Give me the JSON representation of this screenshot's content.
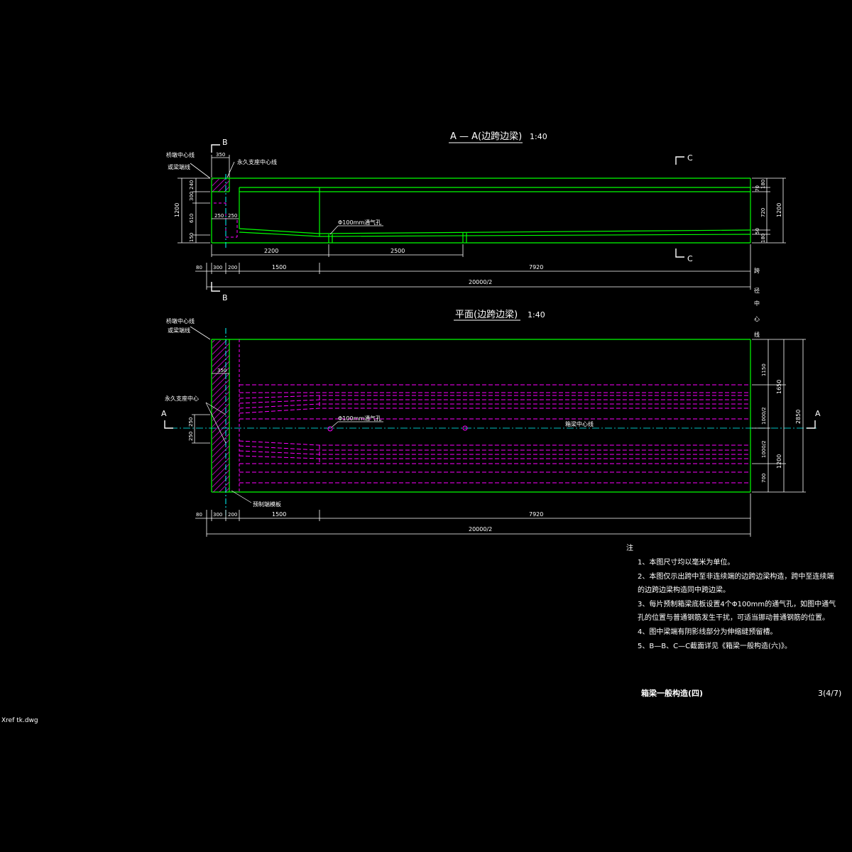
{
  "section_aa": {
    "title": "A — A(边跨边梁)",
    "scale": "1:40",
    "label_joint_line": "桥墩中心线",
    "label_joint_line2": "或梁端线",
    "label_bearing": "永久支座中心线",
    "vent_label": "Φ100mm通气孔",
    "dims": {
      "d350": "350",
      "d240": "240",
      "d300": "300",
      "d610": "610",
      "d150": "150",
      "d1200": "1200",
      "d250a": "250",
      "d250b": "250",
      "d2200": "2200",
      "d2500": "2500",
      "r70": "70",
      "r180": "180",
      "r720": "720",
      "r50": "50",
      "r180b": "180",
      "r1200": "1200",
      "d80": "80",
      "d300b": "300",
      "d200": "200",
      "d1500": "1500",
      "d7920": "7920",
      "total": "20000/2"
    },
    "cut_b": "B",
    "cut_c": "C"
  },
  "plan": {
    "title": "平面(边跨边梁)",
    "scale": "1:40",
    "label_joint_line": "桥墩中心线",
    "label_joint_line2": "或梁端线",
    "label_bearing": "永久支座中心",
    "label_prestress": "预制端模板",
    "vent_label": "Φ100mm通气孔",
    "centerline_label": "箱梁中心线",
    "span_center": [
      "跨",
      "径",
      "中",
      "心",
      "线"
    ],
    "dims": {
      "d350": "350",
      "d250": "250",
      "d250b": "250",
      "r1150": "1150",
      "r1650": "1650",
      "r1000a": "1000/2",
      "r1000b": "1000/2",
      "r1200": "1200",
      "r700": "700",
      "r2850": "2850",
      "d80": "80",
      "d300": "300",
      "d200": "200",
      "d1500": "1500",
      "d7920": "7920",
      "total": "20000/2"
    },
    "cut_a": "A"
  },
  "notes": {
    "heading": "注",
    "items": [
      "1、本图尺寸均以毫米为单位。",
      "2、本图仅示出跨中至非连续端的边跨边梁构造，跨中至连续端",
      "   的边跨边梁构造同中跨边梁。",
      "3、每片预制箱梁底板设置4个Φ100mm的通气孔，如图中通气",
      "   孔的位置与普通钢筋发生干扰，可适当挪动普通钢筋的位置。",
      "4、图中梁端有阴影线部分为伸缩缝预留槽。",
      "5、B—B、C—C截面详见《箱梁一般构造(六)》。"
    ]
  },
  "title_block": {
    "drawing_title": "箱梁一般构造(四)",
    "sheet": "3(4/7)",
    "xref": "Xref tk.dwg"
  },
  "colors": {
    "background": "#000000",
    "outline": "#00ff00",
    "tendon": "#ff00ff",
    "text": "#ffffff",
    "dim": "#ffffff",
    "axis": "#00ffff"
  }
}
